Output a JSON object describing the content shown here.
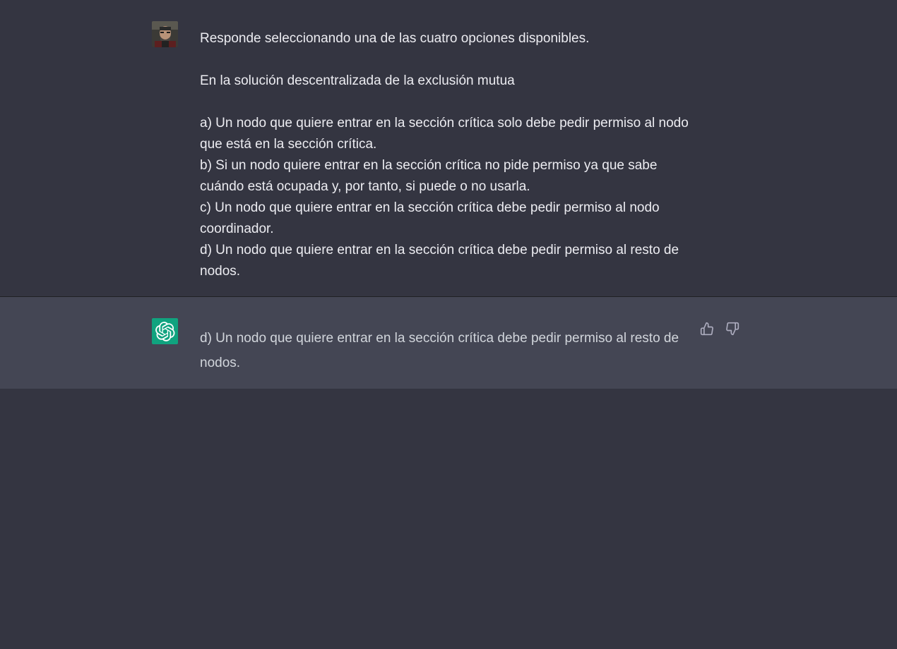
{
  "conversation": {
    "user_message": {
      "avatar_icon": "user-avatar-photo",
      "lines": [
        "Responde seleccionando una de las cuatro opciones disponibles.",
        "",
        "En la solución descentralizada de la exclusión mutua",
        "",
        "a) Un nodo que quiere entrar en la sección crítica solo debe pedir permiso al nodo que está en la sección crítica.",
        "b) Si un nodo quiere entrar en la sección crítica no pide permiso ya que sabe cuándo está ocupada y, por tanto, si puede o no usarla.",
        "c) Un nodo que quiere entrar en la sección crítica debe pedir permiso al nodo coordinador.",
        "d) Un nodo que quiere entrar en la sección crítica debe pedir permiso al resto de nodos."
      ]
    },
    "assistant_message": {
      "avatar_icon": "openai-logo-icon",
      "text": "d) Un nodo que quiere entrar en la sección crítica debe pedir permiso al resto de nodos.",
      "feedback": {
        "thumbs_up_icon": "thumbs-up-icon",
        "thumbs_down_icon": "thumbs-down-icon"
      }
    }
  },
  "colors": {
    "background": "#343541",
    "assistant_background": "#444654",
    "user_text": "#ececf1",
    "assistant_text": "#d1d5db",
    "openai_green": "#10a37f"
  }
}
